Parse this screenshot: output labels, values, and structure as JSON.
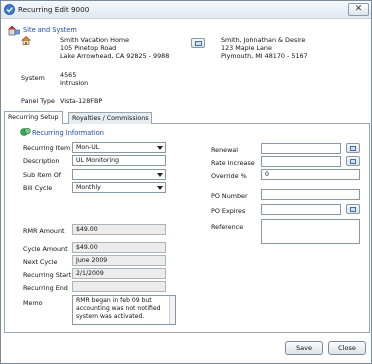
{
  "window": {
    "title": "Recurring Edit 9000",
    "close_label": "✕"
  },
  "site": {
    "section_title": "Site and System",
    "site_name": "Smith Vacation Home",
    "site_address1": "105 Pinetop Road",
    "site_address2": "Lake Arrowhead, CA  92825 - 9988",
    "owner_name": "Smith, Johnathan & Desire",
    "owner_address1": "123 Maple Lane",
    "owner_address2": "Plymouth, MI  48170 - 5167",
    "system_label": "System",
    "system_number": "4565",
    "system_type": "Intrusion",
    "panel_label": "Panel Type",
    "panel_value": "Vista-128FBP"
  },
  "tabs": [
    {
      "label": "Recurring Setup"
    },
    {
      "label": "Royalties / Commissions"
    }
  ],
  "recurring": {
    "section_title": "Recurring Information",
    "item_label": "Recurring Item",
    "item_value": "Mon-UL",
    "description_label": "Description",
    "description_value": "UL Monitoring",
    "sub_item_label": "Sub Item Of",
    "sub_item_value": "",
    "bill_cycle_label": "Bill Cycle",
    "bill_cycle_value": "Monthly",
    "rmr_label": "RMR Amount",
    "rmr_value": "$49.00",
    "cycle_label": "Cycle Amount",
    "cycle_value": "$49.00",
    "next_cycle_label": "Next Cycle",
    "next_cycle_value": "June 2009",
    "start_label": "Recurring Start",
    "start_value": "2/1/2009",
    "end_label": "Recurring End",
    "end_value": "",
    "memo_label": "Memo",
    "memo_value": "RMR began in feb 09 but accounting was not notified system was activated."
  },
  "right": {
    "renewal_label": "Renewal",
    "renewal_value": "",
    "rate_label": "Rate Increase",
    "rate_value": "",
    "override_label": "Override %",
    "override_value": "0",
    "po_number_label": "PO Number",
    "po_number_value": "",
    "po_expires_label": "PO Expires",
    "po_expires_value": "",
    "reference_label": "Reference"
  },
  "footer": {
    "save_label": "Save",
    "close_label": "Close"
  }
}
